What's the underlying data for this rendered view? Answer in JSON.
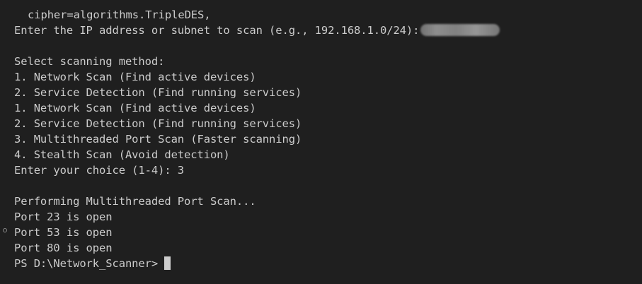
{
  "terminal": {
    "lines": [
      "cipher=algorithms.TripleDES,",
      "Enter the IP address or subnet to scan (e.g., 192.168.1.0/24):",
      "",
      "Select scanning method:",
      "1. Network Scan (Find active devices)",
      "2. Service Detection (Find running services)",
      "1. Network Scan (Find active devices)",
      "2. Service Detection (Find running services)",
      "3. Multithreaded Port Scan (Faster scanning)",
      "4. Stealth Scan (Avoid detection)",
      "Enter your choice (1-4): 3",
      "",
      "Performing Multithreaded Port Scan...",
      "Port 23 is open",
      "Port 53 is open",
      "Port 80 is open"
    ],
    "prompt": "PS D:\\Network_Scanner>"
  },
  "colors": {
    "background": "#1f1f1f",
    "text": "#cccccc"
  }
}
